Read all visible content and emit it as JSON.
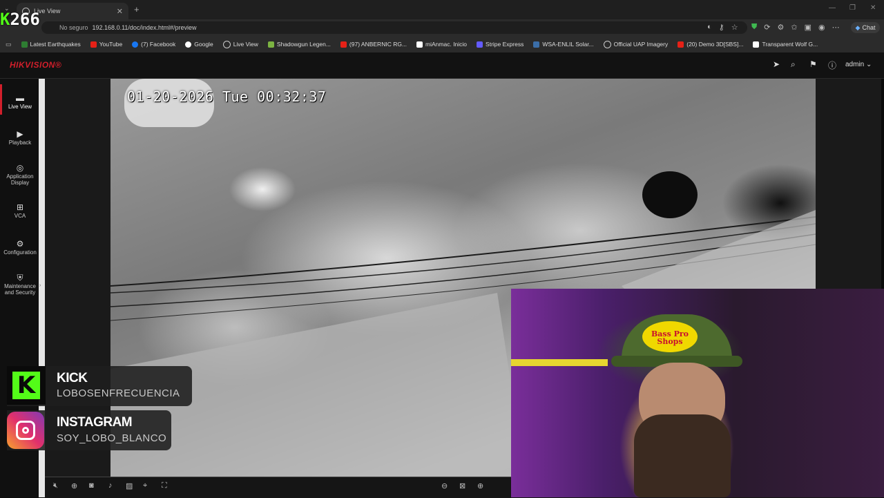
{
  "browser": {
    "tab_title": "Live View",
    "new_tab": "+",
    "url_security": "No seguro",
    "url": "192.168.0.11/doc/index.html#/preview",
    "chat_label": "Chat",
    "bookmarks": [
      {
        "label": "Latest Earthquakes",
        "color": "#2e7d32"
      },
      {
        "label": "YouTube",
        "color": "#e62117"
      },
      {
        "label": "(7) Facebook",
        "color": "#1877f2"
      },
      {
        "label": "Google",
        "color": "#ffffff"
      },
      {
        "label": "Live View",
        "color": "#dddddd"
      },
      {
        "label": "Shadowgun Legen...",
        "color": "#7cb342"
      },
      {
        "label": "(97) ANBERNIC RG...",
        "color": "#e62117"
      },
      {
        "label": "miAnmac. Inicio",
        "color": "#ffffff"
      },
      {
        "label": "Stripe Express",
        "color": "#635bff"
      },
      {
        "label": "WSA-ENLIL Solar...",
        "color": "#3b6ea8"
      },
      {
        "label": "Official UAP Imagery",
        "color": "#cccccc"
      },
      {
        "label": "(20) Demo 3D[SBS]...",
        "color": "#e62117"
      },
      {
        "label": "Transparent Wolf G...",
        "color": "#ffffff"
      }
    ]
  },
  "app": {
    "brand": "HIKVISION®",
    "brand_color": "#d21f2b",
    "user": "admin",
    "header_icons": [
      "send-icon",
      "search-icon",
      "bookmark-icon",
      "info-icon"
    ]
  },
  "sidebar": {
    "items": [
      {
        "label": "Live View",
        "icon": "monitor-icon",
        "active": true
      },
      {
        "label": "Playback",
        "icon": "play-icon"
      },
      {
        "label": "Application Display",
        "icon": "app-icon"
      },
      {
        "label": "VCA",
        "icon": "grid-icon"
      },
      {
        "label": "Configuration",
        "icon": "gear-icon"
      },
      {
        "label": "Maintenance and Security",
        "icon": "shield-icon"
      }
    ]
  },
  "video": {
    "timestamp": "01-20-2026 Tue 00:32:37"
  },
  "toolbar": {
    "left_icons": [
      "mute-icon",
      "zoom-icon",
      "camera-icon",
      "mic-icon",
      "image-icon",
      "focus-icon",
      "capture-icon"
    ],
    "right_icons": [
      "prev-icon",
      "stop-icon",
      "next-icon"
    ]
  },
  "overlay": {
    "counter_prefix": "K",
    "counter": "266",
    "kick_title": "KICK",
    "kick_handle": "LOBOSENFRECUENCIA",
    "kick_logo": "K",
    "kick_color": "#53fc18",
    "ig_title": "INSTAGRAM",
    "ig_handle": "SOY_LOBO_BLANCO",
    "cap_text": "Bass Pro Shops"
  }
}
